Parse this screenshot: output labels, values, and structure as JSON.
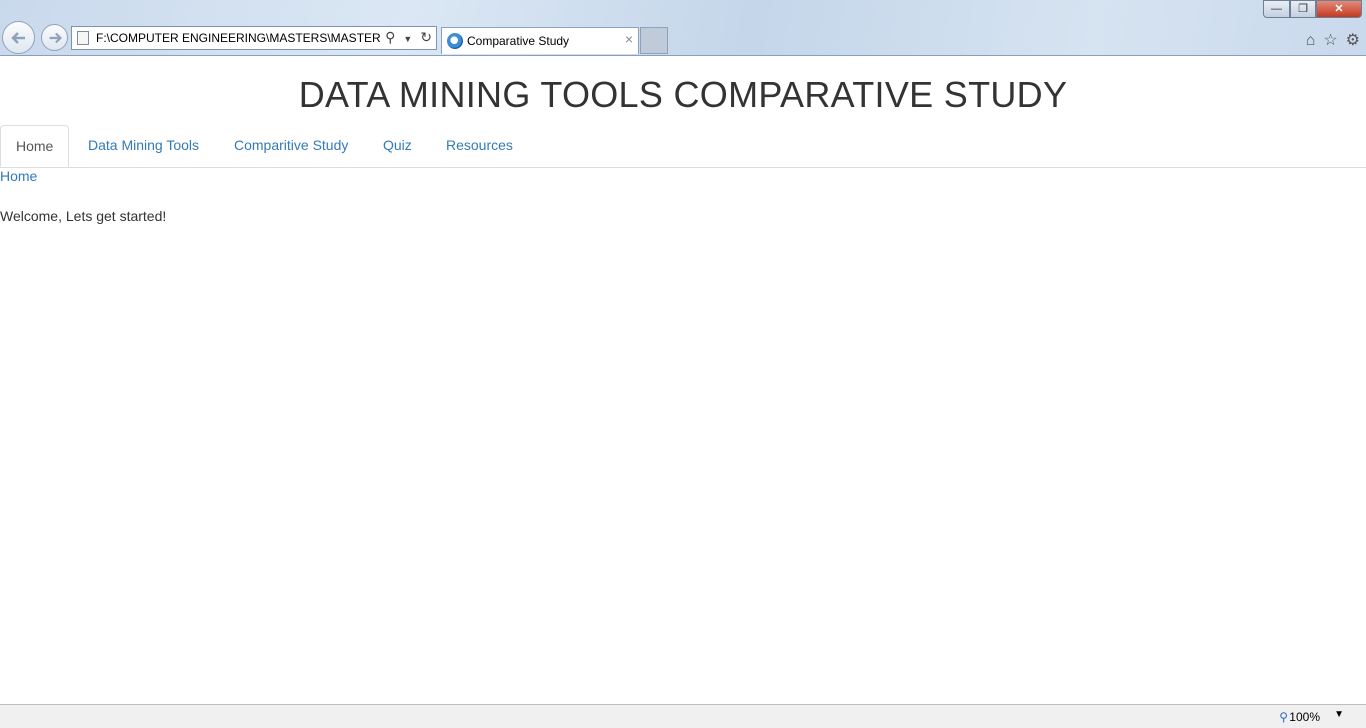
{
  "browser": {
    "address_url": "F:\\COMPUTER ENGINEERING\\MASTERS\\MASTERS PR(",
    "tab_title": "Comparative Study",
    "tab_close": "×",
    "win_min": "—",
    "win_max": "❐",
    "win_close": "✕",
    "zoom_level": "100%",
    "icons": [
      "back-arrow-icon",
      "forward-arrow-icon",
      "page-icon",
      "search-icon",
      "dropdown-icon",
      "refresh-icon",
      "ie-icon",
      "home-icon",
      "favorites-star-icon",
      "gear-icon",
      "zoom-icon"
    ]
  },
  "page": {
    "title": "DATA MINING TOOLS COMPARATIVE STUDY",
    "nav": [
      {
        "label": "Home",
        "active": true
      },
      {
        "label": "Data Mining Tools",
        "active": false
      },
      {
        "label": "Comparitive Study",
        "active": false
      },
      {
        "label": "Quiz",
        "active": false
      },
      {
        "label": "Resources",
        "active": false
      }
    ],
    "breadcrumb": "Home",
    "welcome": "Welcome, Lets get started!"
  },
  "colors": {
    "link": "#337ab7",
    "text": "#333333",
    "chrome": "#c9d9ec"
  }
}
